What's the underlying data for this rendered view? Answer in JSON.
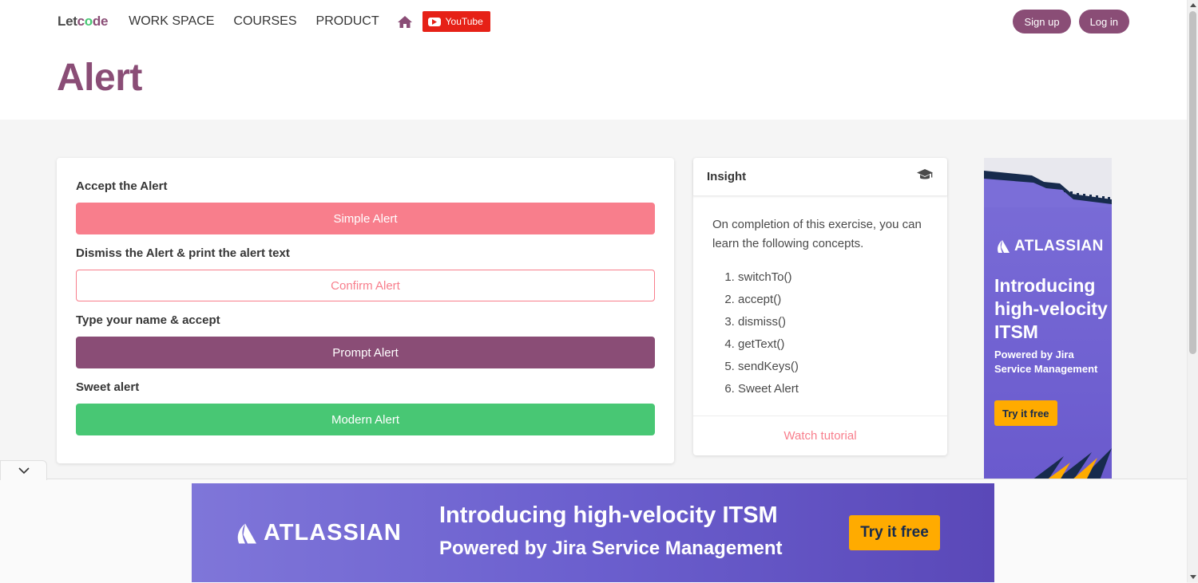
{
  "nav": {
    "logo": {
      "part1": "Let",
      "part2": "c",
      "part3": "o",
      "part4": "de"
    },
    "links": [
      "WORK SPACE",
      "COURSES",
      "PRODUCT"
    ],
    "youtube_label": "YouTube",
    "signup": "Sign up",
    "login": "Log in"
  },
  "page": {
    "title": "Alert"
  },
  "alerts": {
    "simple": {
      "label": "Accept the Alert",
      "button": "Simple Alert"
    },
    "confirm": {
      "label": "Dismiss the Alert & print the alert text",
      "button": "Confirm Alert"
    },
    "prompt": {
      "label": "Type your name & accept",
      "button": "Prompt Alert"
    },
    "modern": {
      "label": "Sweet alert",
      "button": "Modern Alert"
    }
  },
  "insight": {
    "title": "Insight",
    "intro": "On completion of this exercise, you can learn the following concepts.",
    "concepts": [
      "switchTo()",
      "accept()",
      "dismiss()",
      "getText()",
      "sendKeys()",
      "Sweet Alert"
    ],
    "footer_link": "Watch tutorial"
  },
  "side_ad": {
    "brand": "ATLASSIAN",
    "headline": "Introducing high-velocity ITSM",
    "sub": "Powered by Jira Service Management",
    "cta": "Try it free"
  },
  "bottom_ad": {
    "brand": "ATLASSIAN",
    "headline": "Introducing high-velocity ITSM",
    "sub": "Powered by Jira Service Management",
    "cta": "Try it free"
  },
  "colors": {
    "brand_purple": "#8a4d76",
    "danger_pink": "#f87e8c",
    "success_green": "#48c774",
    "ad_purple": "#6a5acd",
    "cta_yellow": "#ffab00",
    "youtube_red": "#e62117"
  },
  "icons": {
    "home": "home-icon",
    "youtube": "youtube-play-icon",
    "insight": "graduation-cap-icon",
    "collapse": "chevron-down-icon",
    "atlassian": "atlassian-logo-icon"
  }
}
